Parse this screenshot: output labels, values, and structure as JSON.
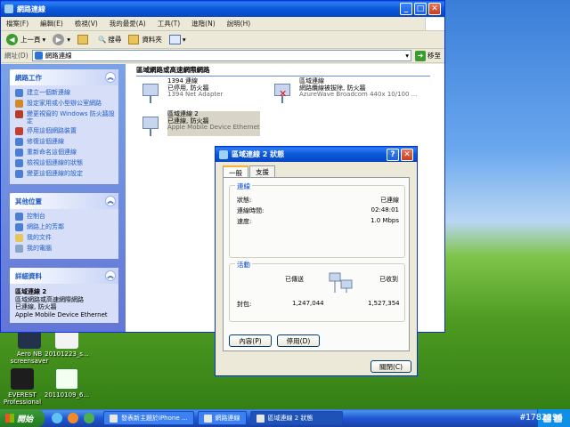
{
  "explorer": {
    "title": "網路連線",
    "menu": [
      "檔案(F)",
      "編輯(E)",
      "檢視(V)",
      "我的最愛(A)",
      "工具(T)",
      "進階(N)",
      "說明(H)"
    ],
    "toolbar": {
      "back": "上一頁",
      "search": "搜尋",
      "folders": "資料夾"
    },
    "address": {
      "label": "網址(D)",
      "value": "網路連線",
      "go": "移至"
    },
    "taskpane": {
      "network_tasks": {
        "title": "網路工作",
        "items": [
          "建立一個新連線",
          "設定家用或小型辦公室網路",
          "變更視窗的 Windows 防火牆設定",
          "停用這個網路裝置",
          "修復這個連線",
          "重新命名這個連線",
          "檢視這個連線的狀態",
          "變更這個連線的設定"
        ]
      },
      "other_places": {
        "title": "其他位置",
        "items": [
          "控制台",
          "網路上的芳鄰",
          "我的文件",
          "我的電腦"
        ]
      },
      "details": {
        "title": "詳細資料",
        "name": "區域連線 2",
        "type": "區域網路或高速網際網路",
        "status": "已連線, 防火牆",
        "device": "Apple Mobile Device Ethernet"
      }
    },
    "group_header": "區域網路或高速網際網路",
    "connections": [
      {
        "name": "1394 連線",
        "status": "已停用, 防火牆",
        "device": "1394 Net Adapter"
      },
      {
        "name": "區域連線",
        "status": "網路纜線被拔除, 防火牆",
        "device": "AzureWave Broadcom 440x 10/100 ..."
      },
      {
        "name": "區域連線 2",
        "status": "已連線, 防火牆",
        "device": "Apple Mobile Device Ethernet"
      }
    ]
  },
  "dialog": {
    "title": "區域連線 2 狀態",
    "tabs": [
      "一般",
      "支援"
    ],
    "connection_group": "連線",
    "rows": [
      {
        "label": "狀態:",
        "value": "已連線"
      },
      {
        "label": "連線時間:",
        "value": "02:48:01"
      },
      {
        "label": "速度:",
        "value": "1.0 Mbps"
      }
    ],
    "activity_group": "活動",
    "sent_label": "已傳送",
    "received_label": "已收到",
    "packets_label": "封包:",
    "sent_value": "1,247,044",
    "received_value": "1,527,354",
    "properties_btn": "內容(P)",
    "disable_btn": "停用(D)",
    "close_btn": "關閉(C)"
  },
  "desktop": {
    "icons": [
      {
        "label": "Aero NB screensaver"
      },
      {
        "label": "20101223_s..."
      },
      {
        "label": "EVEREST Professional"
      },
      {
        "label": "20110109_6..."
      }
    ]
  },
  "taskbar": {
    "start": "開始",
    "buttons": [
      "發表新主題於iPhone ...",
      "網路連線",
      "區域連線 2 狀態"
    ],
    "watermark": "#1782296"
  }
}
